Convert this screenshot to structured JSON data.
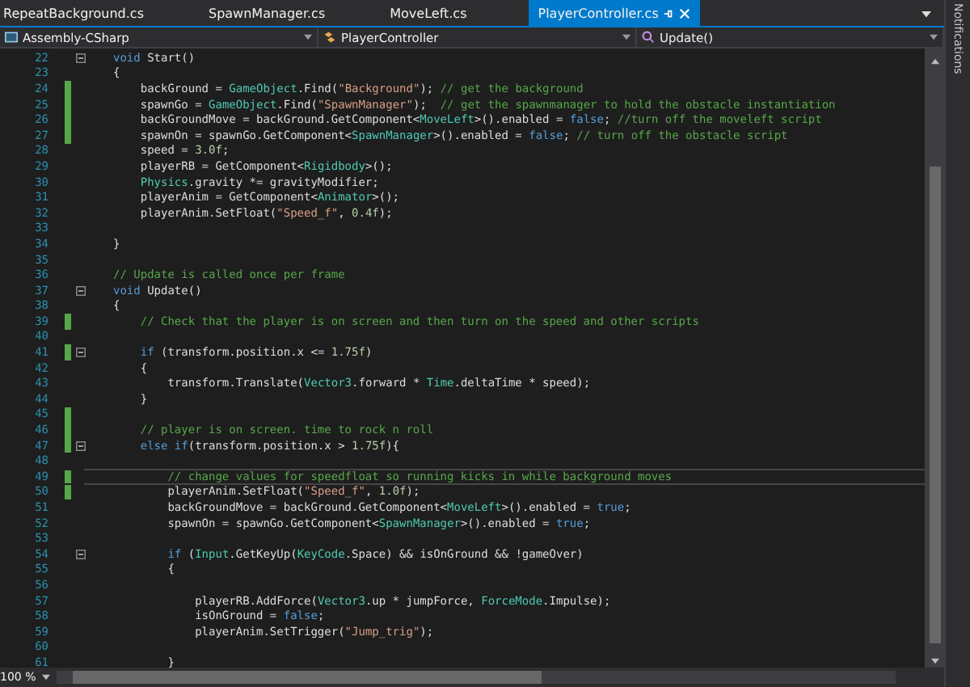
{
  "tabs": [
    {
      "label": "RepeatBackground.cs",
      "selected": false
    },
    {
      "label": "SpawnManager.cs",
      "selected": false
    },
    {
      "label": "MoveLeft.cs",
      "selected": false
    },
    {
      "label": "PlayerController.cs",
      "selected": true
    }
  ],
  "nav": {
    "project": "Assembly-CSharp",
    "class": "PlayerController",
    "member": "Update()"
  },
  "side_panel": {
    "label": "Notifications"
  },
  "lines": [
    {
      "number": "22",
      "changed": false,
      "fold": true,
      "current": false,
      "tokens": [
        {
          "kind": "keyword",
          "text": "void"
        },
        {
          "kind": "plain",
          "text": " Start()"
        }
      ]
    },
    {
      "number": "23",
      "changed": false,
      "fold": false,
      "current": false,
      "tokens": [
        {
          "kind": "plain",
          "text": "{"
        }
      ]
    },
    {
      "number": "24",
      "changed": true,
      "fold": false,
      "current": false,
      "tokens": [
        {
          "kind": "plain",
          "text": "    backGround = "
        },
        {
          "kind": "type",
          "text": "GameObject"
        },
        {
          "kind": "plain",
          "text": ".Find("
        },
        {
          "kind": "string",
          "text": "\"Background\""
        },
        {
          "kind": "plain",
          "text": "); "
        },
        {
          "kind": "comment",
          "text": "// get the background"
        }
      ]
    },
    {
      "number": "25",
      "changed": true,
      "fold": false,
      "current": false,
      "tokens": [
        {
          "kind": "plain",
          "text": "    spawnGo = "
        },
        {
          "kind": "type",
          "text": "GameObject"
        },
        {
          "kind": "plain",
          "text": ".Find("
        },
        {
          "kind": "string",
          "text": "\"SpawnManager\""
        },
        {
          "kind": "plain",
          "text": ");  "
        },
        {
          "kind": "comment",
          "text": "// get the spawnmanager to hold the obstacle instantiation"
        }
      ]
    },
    {
      "number": "26",
      "changed": true,
      "fold": false,
      "current": false,
      "tokens": [
        {
          "kind": "plain",
          "text": "    backGroundMove = backGround.GetComponent<"
        },
        {
          "kind": "type",
          "text": "MoveLeft"
        },
        {
          "kind": "plain",
          "text": ">().enabled = "
        },
        {
          "kind": "keyword",
          "text": "false"
        },
        {
          "kind": "plain",
          "text": "; "
        },
        {
          "kind": "comment",
          "text": "//turn off the moveleft script"
        }
      ]
    },
    {
      "number": "27",
      "changed": true,
      "fold": false,
      "current": false,
      "tokens": [
        {
          "kind": "plain",
          "text": "    spawnOn = spawnGo.GetComponent<"
        },
        {
          "kind": "type",
          "text": "SpawnManager"
        },
        {
          "kind": "plain",
          "text": ">().enabled = "
        },
        {
          "kind": "keyword",
          "text": "false"
        },
        {
          "kind": "plain",
          "text": "; "
        },
        {
          "kind": "comment",
          "text": "// turn off the obstacle script"
        }
      ]
    },
    {
      "number": "28",
      "changed": false,
      "fold": false,
      "current": false,
      "tokens": [
        {
          "kind": "plain",
          "text": "    speed = "
        },
        {
          "kind": "number",
          "text": "3.0f"
        },
        {
          "kind": "plain",
          "text": ";"
        }
      ]
    },
    {
      "number": "29",
      "changed": false,
      "fold": false,
      "current": false,
      "tokens": [
        {
          "kind": "plain",
          "text": "    playerRB = GetComponent<"
        },
        {
          "kind": "type",
          "text": "Rigidbody"
        },
        {
          "kind": "plain",
          "text": ">();"
        }
      ]
    },
    {
      "number": "30",
      "changed": false,
      "fold": false,
      "current": false,
      "tokens": [
        {
          "kind": "type",
          "text": "    Physics"
        },
        {
          "kind": "plain",
          "text": ".gravity *= gravityModifier;"
        }
      ]
    },
    {
      "number": "31",
      "changed": false,
      "fold": false,
      "current": false,
      "tokens": [
        {
          "kind": "plain",
          "text": "    playerAnim = GetComponent<"
        },
        {
          "kind": "type",
          "text": "Animator"
        },
        {
          "kind": "plain",
          "text": ">();"
        }
      ]
    },
    {
      "number": "32",
      "changed": false,
      "fold": false,
      "current": false,
      "tokens": [
        {
          "kind": "plain",
          "text": "    playerAnim.SetFloat("
        },
        {
          "kind": "string",
          "text": "\"Speed_f\""
        },
        {
          "kind": "plain",
          "text": ", "
        },
        {
          "kind": "number",
          "text": "0.4f"
        },
        {
          "kind": "plain",
          "text": ");"
        }
      ]
    },
    {
      "number": "33",
      "changed": false,
      "fold": false,
      "current": false
    },
    {
      "number": "34",
      "changed": false,
      "fold": false,
      "current": false,
      "tokens": [
        {
          "kind": "plain",
          "text": "}"
        }
      ]
    },
    {
      "number": "35",
      "changed": false,
      "fold": false,
      "current": false
    },
    {
      "number": "36",
      "changed": false,
      "fold": false,
      "current": false,
      "tokens": [
        {
          "kind": "comment",
          "text": "// Update is called once per frame"
        }
      ]
    },
    {
      "number": "37",
      "changed": false,
      "fold": true,
      "current": false,
      "tokens": [
        {
          "kind": "keyword",
          "text": "void"
        },
        {
          "kind": "plain",
          "text": " Update()"
        }
      ]
    },
    {
      "number": "38",
      "changed": false,
      "fold": false,
      "current": false,
      "tokens": [
        {
          "kind": "plain",
          "text": "{"
        }
      ]
    },
    {
      "number": "39",
      "changed": true,
      "fold": false,
      "current": false,
      "tokens": [
        {
          "kind": "comment",
          "text": "    // Check that the player is on screen and then turn on the speed and other scripts"
        }
      ]
    },
    {
      "number": "40",
      "changed": false,
      "fold": false,
      "current": false
    },
    {
      "number": "41",
      "changed": true,
      "fold": true,
      "current": false,
      "tokens": [
        {
          "kind": "keyword",
          "text": "    if"
        },
        {
          "kind": "plain",
          "text": " (transform.position.x <= "
        },
        {
          "kind": "number",
          "text": "1.75f"
        },
        {
          "kind": "plain",
          "text": ")"
        }
      ]
    },
    {
      "number": "42",
      "changed": false,
      "fold": false,
      "current": false,
      "tokens": [
        {
          "kind": "plain",
          "text": "    {"
        }
      ]
    },
    {
      "number": "43",
      "changed": false,
      "fold": false,
      "current": false,
      "tokens": [
        {
          "kind": "plain",
          "text": "        transform.Translate("
        },
        {
          "kind": "type",
          "text": "Vector3"
        },
        {
          "kind": "plain",
          "text": ".forward * "
        },
        {
          "kind": "type",
          "text": "Time"
        },
        {
          "kind": "plain",
          "text": ".deltaTime * speed);"
        }
      ]
    },
    {
      "number": "44",
      "changed": false,
      "fold": false,
      "current": false,
      "tokens": [
        {
          "kind": "plain",
          "text": "    }"
        }
      ]
    },
    {
      "number": "45",
      "changed": true,
      "fold": false,
      "current": false
    },
    {
      "number": "46",
      "changed": true,
      "fold": false,
      "current": false,
      "tokens": [
        {
          "kind": "comment",
          "text": "    // player is on screen. time to rock n roll"
        }
      ]
    },
    {
      "number": "47",
      "changed": true,
      "fold": true,
      "current": false,
      "tokens": [
        {
          "kind": "keyword",
          "text": "    else if"
        },
        {
          "kind": "plain",
          "text": "(transform.position.x > "
        },
        {
          "kind": "number",
          "text": "1.75f"
        },
        {
          "kind": "plain",
          "text": "){"
        }
      ]
    },
    {
      "number": "48",
      "changed": false,
      "fold": false,
      "current": false
    },
    {
      "number": "49",
      "changed": true,
      "fold": false,
      "current": true,
      "tokens": [
        {
          "kind": "comment",
          "text": "        // change values for speedfloat so running kicks in while background moves"
        }
      ]
    },
    {
      "number": "50",
      "changed": true,
      "fold": false,
      "current": false,
      "tokens": [
        {
          "kind": "plain",
          "text": "        playerAnim.SetFloat("
        },
        {
          "kind": "string",
          "text": "\"Speed_f\""
        },
        {
          "kind": "plain",
          "text": ", "
        },
        {
          "kind": "number",
          "text": "1.0f"
        },
        {
          "kind": "plain",
          "text": ");"
        }
      ]
    },
    {
      "number": "51",
      "changed": false,
      "fold": false,
      "current": false,
      "tokens": [
        {
          "kind": "plain",
          "text": "        backGroundMove = backGround.GetComponent<"
        },
        {
          "kind": "type",
          "text": "MoveLeft"
        },
        {
          "kind": "plain",
          "text": ">().enabled = "
        },
        {
          "kind": "keyword",
          "text": "true"
        },
        {
          "kind": "plain",
          "text": ";"
        }
      ]
    },
    {
      "number": "52",
      "changed": false,
      "fold": false,
      "current": false,
      "tokens": [
        {
          "kind": "plain",
          "text": "        spawnOn = spawnGo.GetComponent<"
        },
        {
          "kind": "type",
          "text": "SpawnManager"
        },
        {
          "kind": "plain",
          "text": ">().enabled = "
        },
        {
          "kind": "keyword",
          "text": "true"
        },
        {
          "kind": "plain",
          "text": ";"
        }
      ]
    },
    {
      "number": "53",
      "changed": false,
      "fold": false,
      "current": false
    },
    {
      "number": "54",
      "changed": false,
      "fold": true,
      "current": false,
      "tokens": [
        {
          "kind": "keyword",
          "text": "        if"
        },
        {
          "kind": "plain",
          "text": " ("
        },
        {
          "kind": "type",
          "text": "Input"
        },
        {
          "kind": "plain",
          "text": ".GetKeyUp("
        },
        {
          "kind": "type",
          "text": "KeyCode"
        },
        {
          "kind": "plain",
          "text": ".Space) && isOnGround && !gameOver)"
        }
      ]
    },
    {
      "number": "55",
      "changed": false,
      "fold": false,
      "current": false,
      "tokens": [
        {
          "kind": "plain",
          "text": "        {"
        }
      ]
    },
    {
      "number": "56",
      "changed": false,
      "fold": false,
      "current": false
    },
    {
      "number": "57",
      "changed": false,
      "fold": false,
      "current": false,
      "tokens": [
        {
          "kind": "plain",
          "text": "            playerRB.AddForce("
        },
        {
          "kind": "type",
          "text": "Vector3"
        },
        {
          "kind": "plain",
          "text": ".up * jumpForce, "
        },
        {
          "kind": "type",
          "text": "ForceMode"
        },
        {
          "kind": "plain",
          "text": ".Impulse);"
        }
      ]
    },
    {
      "number": "58",
      "changed": false,
      "fold": false,
      "current": false,
      "tokens": [
        {
          "kind": "plain",
          "text": "            isOnGround = "
        },
        {
          "kind": "keyword",
          "text": "false"
        },
        {
          "kind": "plain",
          "text": ";"
        }
      ]
    },
    {
      "number": "59",
      "changed": false,
      "fold": false,
      "current": false,
      "tokens": [
        {
          "kind": "plain",
          "text": "            playerAnim.SetTrigger("
        },
        {
          "kind": "string",
          "text": "\"Jump_trig\""
        },
        {
          "kind": "plain",
          "text": ");"
        }
      ]
    },
    {
      "number": "60",
      "changed": false,
      "fold": false,
      "current": false
    },
    {
      "number": "61",
      "changed": false,
      "fold": false,
      "current": false,
      "tokens": [
        {
          "kind": "plain",
          "text": "        }"
        }
      ]
    }
  ],
  "status_bar": {
    "zoom": "100 %"
  }
}
